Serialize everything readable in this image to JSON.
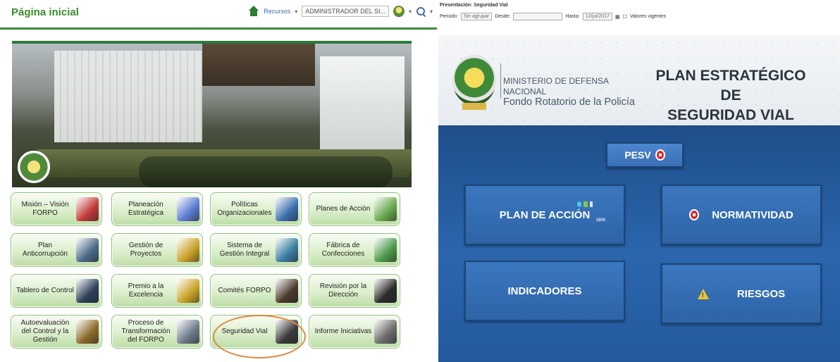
{
  "left": {
    "page_title": "Página inicial",
    "topbar": {
      "resources_label": "Recursos",
      "user_label": "ADMINISTRADOR DEL SI..."
    },
    "tiles": [
      {
        "label": "Misión – Visión FORPO",
        "icon": "target-icon",
        "icon_color": "#c23a3a"
      },
      {
        "label": "Planeación Estratégica",
        "icon": "chart-icon",
        "icon_color": "#5a7bd1"
      },
      {
        "label": "Políticas Organizacionales",
        "icon": "figure-icon",
        "icon_color": "#3e6fb0"
      },
      {
        "label": "Planes de Acción",
        "icon": "book-icon",
        "icon_color": "#6aa84f"
      },
      {
        "label": "Plan Anticorrupción",
        "icon": "fingerprint-icon",
        "icon_color": "#4d6a88"
      },
      {
        "label": "Gestión de Proyectos",
        "icon": "pencil-icon",
        "icon_color": "#c9a227"
      },
      {
        "label": "Sistema de Gestión Integral",
        "icon": "shield-check-icon",
        "icon_color": "#3b7ea1"
      },
      {
        "label": "Fábrica de Confecciones",
        "icon": "factory-icon",
        "icon_color": "#4f9a4a"
      },
      {
        "label": "Tablero de Control",
        "icon": "dashboard-icon",
        "icon_color": "#2d3f5a"
      },
      {
        "label": "Premio a la Excelencia",
        "icon": "trophy-icon",
        "icon_color": "#c9a227"
      },
      {
        "label": "Comités FORPO",
        "icon": "chess-icon",
        "icon_color": "#4b3a2a"
      },
      {
        "label": "Revisión por la Dirección",
        "icon": "inspection-icon",
        "icon_color": "#2b2b2b"
      },
      {
        "label": "Autoevaluación del Control y la Gestión",
        "icon": "checklist-icon",
        "icon_color": "#8a6a2a"
      },
      {
        "label": "Proceso de Transformación del FORPO",
        "icon": "network-icon",
        "icon_color": "#6c7a89"
      },
      {
        "label": "Seguridad Vial",
        "icon": "road-icon",
        "icon_color": "#3a3a3a"
      },
      {
        "label": "Informe Iniciativas",
        "icon": "clipboard-icon",
        "icon_color": "#6b6b6b"
      }
    ]
  },
  "right": {
    "presentation_title": "Presentación: Seguridad Vial",
    "filters": {
      "period_label": "Periodo:",
      "period_value": "Sin agrupar",
      "from_label": "Desde:",
      "to_label": "Hasta:",
      "to_value": "12/jul/2017",
      "current_label": "Valores vigentes"
    },
    "header": {
      "ministry_line1": "MINISTERIO DE DEFENSA NACIONAL",
      "ministry_line2": "Fondo Rotatorio de la Policía",
      "plan_title_line1": "PLAN ESTRATÉGICO DE",
      "plan_title_line2": "SEGURIDAD VIAL"
    },
    "buttons": {
      "pesv": "PESV",
      "plan_accion": "PLAN DE ACCIÓN",
      "plan_accion_sub": "1800",
      "normatividad": "NORMATIVIDAD",
      "indicadores": "INDICADORES",
      "riesgos": "RIESGOS"
    }
  }
}
